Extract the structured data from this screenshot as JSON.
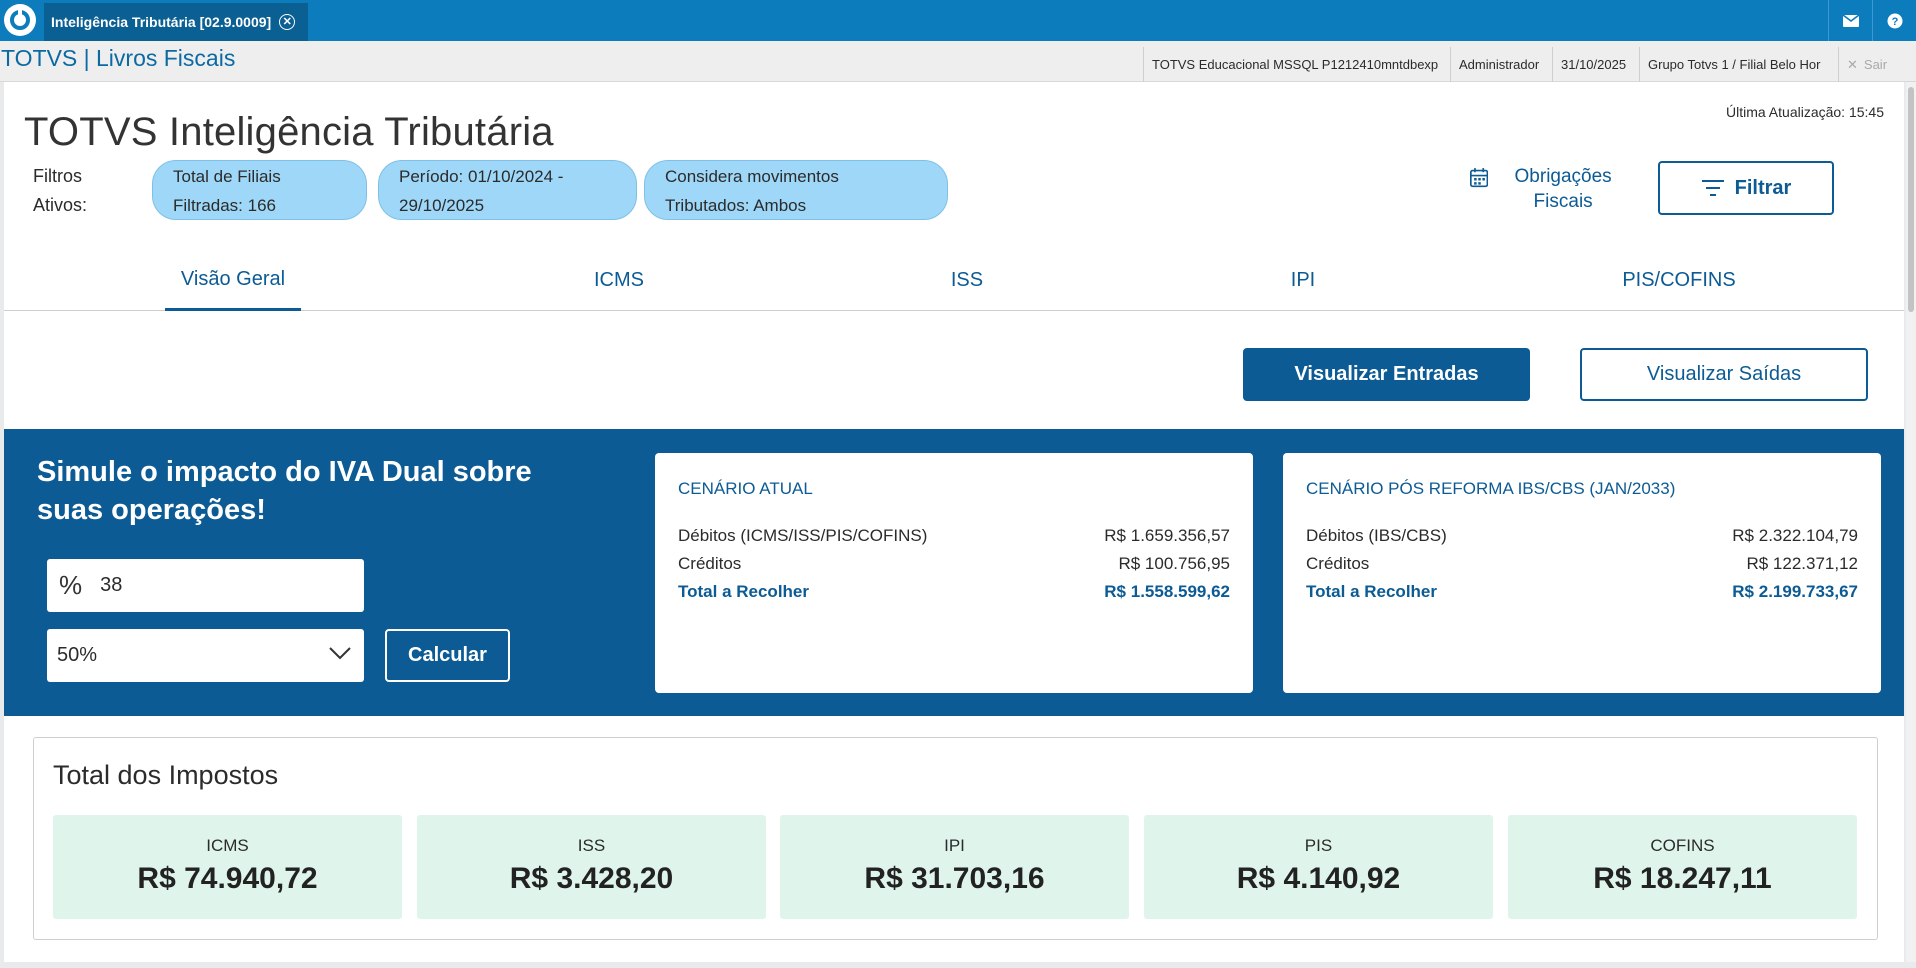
{
  "appbar": {
    "tab_title": "Inteligência Tributária [02.9.0009]"
  },
  "subbar": {
    "brand": "TOTVS | Livros Fiscais",
    "environment": "TOTVS Educacional MSSQL P1212410mntdbexp",
    "user": "Administrador",
    "date": "31/10/2025",
    "branch": "Grupo Totvs 1 / Filial Belo Hor",
    "logout": "Sair"
  },
  "header": {
    "title": "TOTVS Inteligência Tributária",
    "last_update": "Última Atualização: 15:45",
    "filters_label": "Filtros Ativos:",
    "filters": [
      "Total de Filiais Filtradas: 166",
      "Período: 01/10/2024 - 29/10/2025",
      "Considera movimentos Tributados: Ambos"
    ],
    "obrigacoes_label": "Obrigações Fiscais",
    "filtrar_label": "Filtrar"
  },
  "tabs": [
    {
      "label": "Visão Geral",
      "active": true
    },
    {
      "label": "ICMS",
      "active": false
    },
    {
      "label": "ISS",
      "active": false
    },
    {
      "label": "IPI",
      "active": false
    },
    {
      "label": "PIS/COFINS",
      "active": false
    }
  ],
  "actions": {
    "entradas": "Visualizar Entradas",
    "saidas": "Visualizar Saídas"
  },
  "simulation": {
    "title": "Simule o impacto do IVA Dual sobre suas operações!",
    "rate_value": "38",
    "select_value": "50%",
    "calculate": "Calcular",
    "current": {
      "title": "CENÁRIO ATUAL",
      "rows": [
        {
          "label": "Débitos (ICMS/ISS/PIS/COFINS)",
          "value": "R$ 1.659.356,57"
        },
        {
          "label": "Créditos",
          "value": "R$ 100.756,95"
        },
        {
          "label": "Total a Recolher",
          "value": "R$ 1.558.599,62"
        }
      ]
    },
    "reform": {
      "title": "CENÁRIO PÓS REFORMA IBS/CBS (JAN/2033)",
      "rows": [
        {
          "label": "Débitos (IBS/CBS)",
          "value": "R$ 2.322.104,79"
        },
        {
          "label": "Créditos",
          "value": "R$ 122.371,12"
        },
        {
          "label": "Total a Recolher",
          "value": "R$ 2.199.733,67"
        }
      ]
    }
  },
  "totals": {
    "title": "Total dos Impostos",
    "items": [
      {
        "label": "ICMS",
        "value": "R$ 74.940,72"
      },
      {
        "label": "ISS",
        "value": "R$ 3.428,20"
      },
      {
        "label": "IPI",
        "value": "R$ 31.703,16"
      },
      {
        "label": "PIS",
        "value": "R$ 4.140,92"
      },
      {
        "label": "COFINS",
        "value": "R$ 18.247,11"
      }
    ]
  },
  "colors": {
    "topbar": "#0c7cbc",
    "primary": "#0c5b94",
    "chip": "#9ed7f7",
    "tax_card": "#dff5ec"
  }
}
